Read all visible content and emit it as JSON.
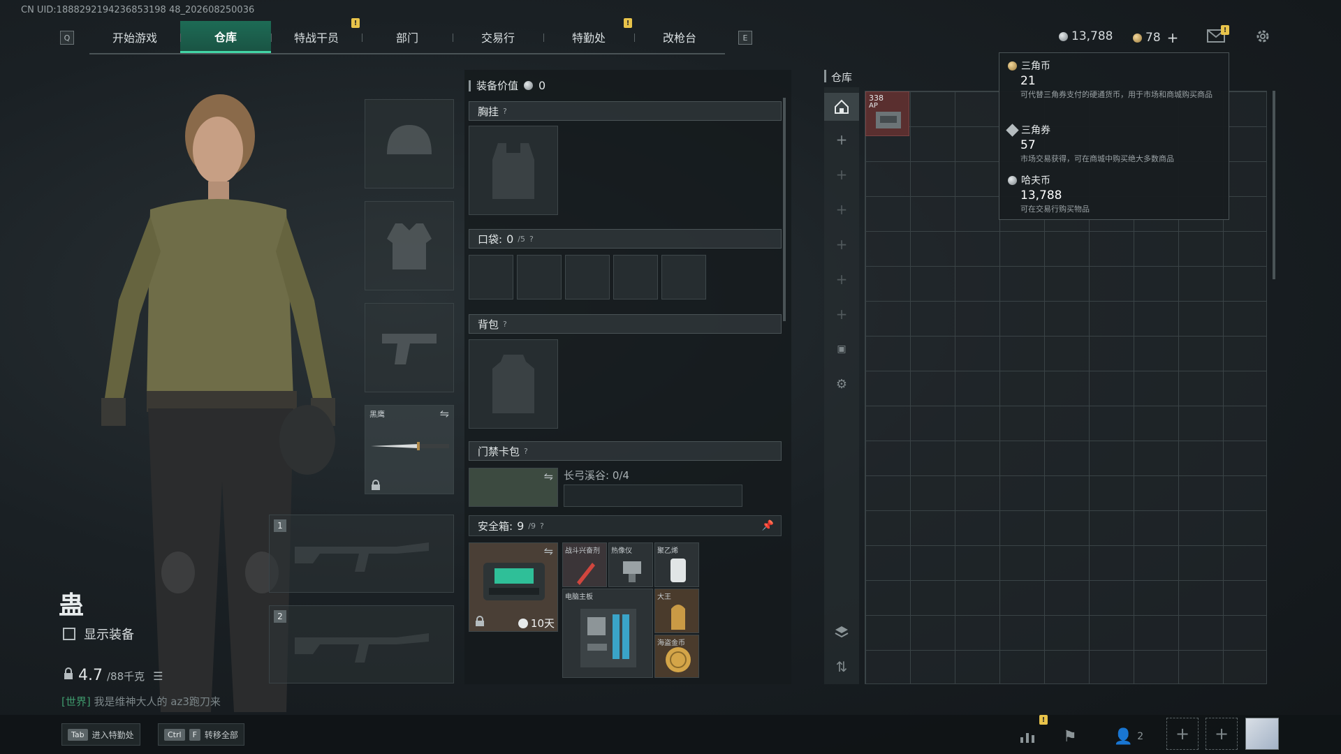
{
  "uid_text": "CN UID:1888292194236853198 48_202608250036",
  "nav": {
    "left_key": "Q",
    "right_key": "E",
    "tabs": [
      "开始游戏",
      "仓库",
      "特战干员",
      "部门",
      "交易行",
      "特勤处",
      "改枪台"
    ],
    "active_tab": "仓库",
    "notif_mark": "!"
  },
  "currency": {
    "hafu_amount": "13,788",
    "triangle_amount": "78",
    "plus": "+"
  },
  "character": {
    "name": "蛊",
    "show_equipment_label": "显示装备",
    "weight_current": "4.7",
    "weight_max": "/88千克"
  },
  "chat": {
    "channel": "[世界]",
    "message": "我是维神大人的 az3跑刀来"
  },
  "equipment": {
    "melee_label": "黑鹰",
    "weapon_slot_1": "1",
    "weapon_slot_2": "2"
  },
  "middle": {
    "equip_value_label": "装备价值",
    "equip_value": "0",
    "chest_rig_label": "胸挂",
    "pockets_label": "口袋:",
    "pockets_count": "0",
    "pockets_total": "/5",
    "backpack_label": "背包",
    "keycard_label": "门禁卡包",
    "keycard_map": "长弓溪谷: 0/4",
    "safebox_label": "安全箱:",
    "safebox_count": "9",
    "safebox_total": "/9",
    "safebox_timer": "10天",
    "question": "?",
    "safe_items": [
      {
        "label": "战斗兴奋剂"
      },
      {
        "label": "热像仪"
      },
      {
        "label": "聚乙烯"
      },
      {
        "label": "电脑主板"
      },
      {
        "label": "大王"
      },
      {
        "label": "海盗金币"
      }
    ]
  },
  "warehouse": {
    "title": "仓库",
    "item_count_label": "338",
    "item_ammo_label": "AP"
  },
  "tooltip": {
    "items": [
      {
        "name": "三角币",
        "value": "21",
        "desc": "可代替三角券支付的硬通货币，用于市场和商城购买商品"
      },
      {
        "name": "三角券",
        "value": "57",
        "desc": "市场交易获得，可在商城中购买绝大多数商品"
      },
      {
        "name": "哈夫币",
        "value": "13,788",
        "desc": "可在交易行购买物品"
      }
    ]
  },
  "bottom": {
    "hint1_key": "Tab",
    "hint1_label": "进入特勤处",
    "hint2_key1": "Ctrl",
    "hint2_key2": "F",
    "hint2_label": "转移全部",
    "friends_count": "2"
  },
  "colors": {
    "accent_green": "#43d6a6",
    "tab_active_bg": "#1d6b55",
    "notif_yellow": "#e8c34a",
    "chat_green": "#3f9a6d"
  }
}
